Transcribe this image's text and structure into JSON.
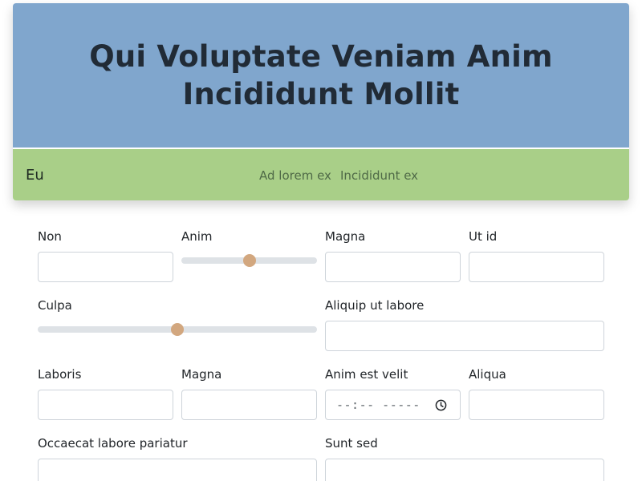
{
  "header": {
    "title": "Qui Voluptate Veniam Anim Incididunt Mollit"
  },
  "navbar": {
    "brand": "Eu",
    "links": [
      "Ad lorem ex",
      "Incididunt ex"
    ]
  },
  "form": {
    "non": {
      "label": "Non",
      "value": ""
    },
    "anim_range": {
      "label": "Anim",
      "value": 50
    },
    "magna_top": {
      "label": "Magna",
      "value": ""
    },
    "ut_id": {
      "label": "Ut id",
      "value": ""
    },
    "culpa_range": {
      "label": "Culpa",
      "value": 50
    },
    "aliquip": {
      "label": "Aliquip ut labore",
      "value": ""
    },
    "laboris": {
      "label": "Laboris",
      "value": ""
    },
    "magna_bottom": {
      "label": "Magna",
      "value": ""
    },
    "anim_est_velit": {
      "label": "Anim est velit",
      "placeholder": "--:-- -----"
    },
    "aliqua": {
      "label": "Aliqua",
      "value": ""
    },
    "occaecat": {
      "label": "Occaecat labore pariatur",
      "value": ""
    },
    "sunt_sed": {
      "label": "Sunt sed",
      "value": ""
    }
  },
  "colors": {
    "hero_bg": "#80a6cd",
    "navbar_bg": "#a9cf88",
    "range_thumb": "#d2a77f"
  }
}
